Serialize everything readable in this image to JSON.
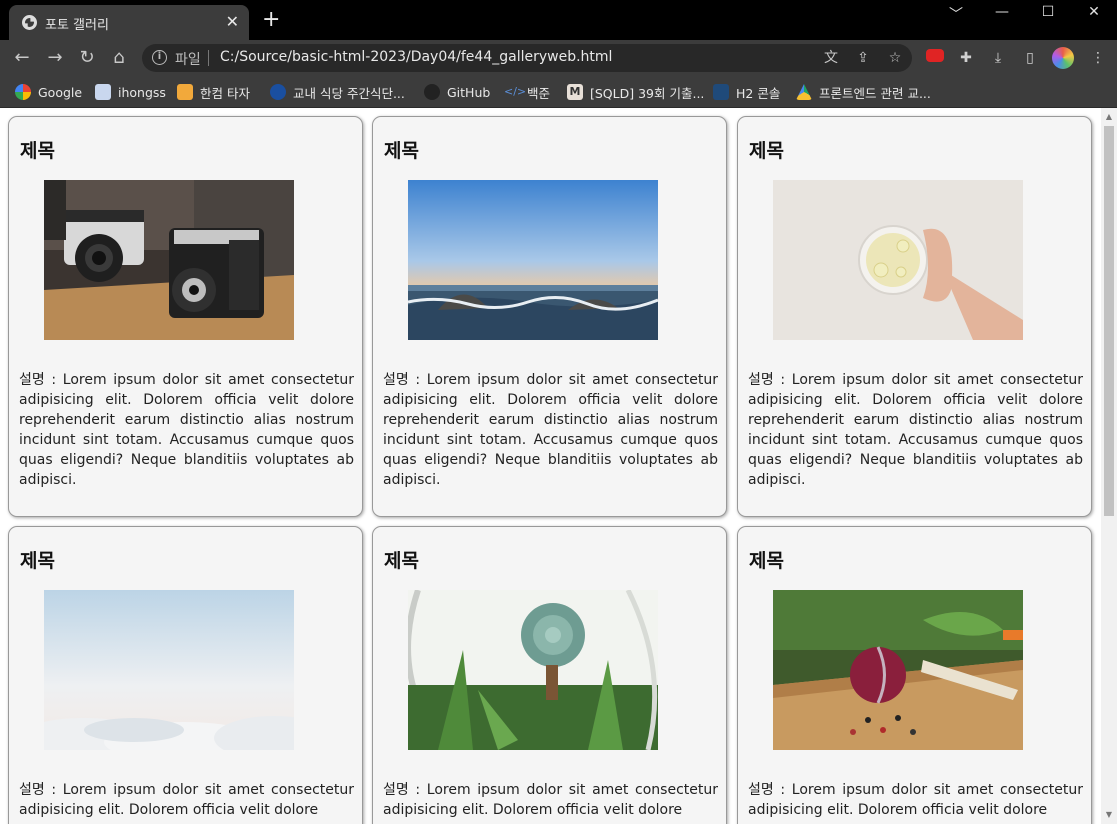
{
  "browser": {
    "tab_title": "포토 갤러리",
    "tab_close": "✕",
    "new_tab": "+",
    "scheme_label": "파일",
    "url": "C:/Source/basic-html-2023/Day04/fe44_galleryweb.html",
    "window_controls": [
      "﹀",
      "—",
      "☐",
      "✕"
    ]
  },
  "bookmarks": [
    {
      "label": "Google",
      "icon": "google-icon",
      "color": "#ffffff"
    },
    {
      "label": "ihongss",
      "icon": "page-icon",
      "color": "#c9d7ee"
    },
    {
      "label": "한컴 타자",
      "icon": "hancom-icon",
      "color": "#f2a93b"
    },
    {
      "label": "교내 식당 주간식단...",
      "icon": "school-icon",
      "color": "#1a4fa0"
    },
    {
      "label": "GitHub",
      "icon": "github-icon",
      "color": "#222222"
    },
    {
      "label": "백준",
      "icon": "code-icon",
      "color": "#3a6fb0"
    },
    {
      "label": "[SQLD] 39회 기출...",
      "icon": "medium-icon",
      "color": "#e8e0d8"
    },
    {
      "label": "H2 콘솔",
      "icon": "h2-icon",
      "color": "#1f4a7a"
    },
    {
      "label": "프론트엔드 관련 교...",
      "icon": "drive-icon",
      "color": "#f6c033"
    }
  ],
  "cards": [
    {
      "title": "제목",
      "photo": "vintage-cameras",
      "description": "설명 : Lorem ipsum dolor sit amet consectetur adipisicing elit. Dolorem officia velit dolore reprehenderit earum distinctio alias nostrum incidunt sint totam. Accusamus cumque quos quas eligendi? Neque blanditiis voluptates ab adipisci."
    },
    {
      "title": "제목",
      "photo": "ocean-waves",
      "description": "설명 : Lorem ipsum dolor sit amet consectetur adipisicing elit. Dolorem officia velit dolore reprehenderit earum distinctio alias nostrum incidunt sint totam. Accusamus cumque quos quas eligendi? Neque blanditiis voluptates ab adipisci."
    },
    {
      "title": "제목",
      "photo": "lemon-tea",
      "description": "설명 : Lorem ipsum dolor sit amet consectetur adipisicing elit. Dolorem officia velit dolore reprehenderit earum distinctio alias nostrum incidunt sint totam. Accusamus cumque quos quas eligendi? Neque blanditiis voluptates ab adipisci."
    },
    {
      "title": "제목",
      "photo": "sky-clouds",
      "description": "설명 : Lorem ipsum dolor sit amet consectetur adipisicing elit. Dolorem officia velit dolore"
    },
    {
      "title": "제목",
      "photo": "terrarium-succulent",
      "description": "설명 : Lorem ipsum dolor sit amet consectetur adipisicing elit. Dolorem officia velit dolore"
    },
    {
      "title": "제목",
      "photo": "onion-spices",
      "description": "설명 : Lorem ipsum dolor sit amet consectetur adipisicing elit. Dolorem officia velit dolore"
    }
  ]
}
